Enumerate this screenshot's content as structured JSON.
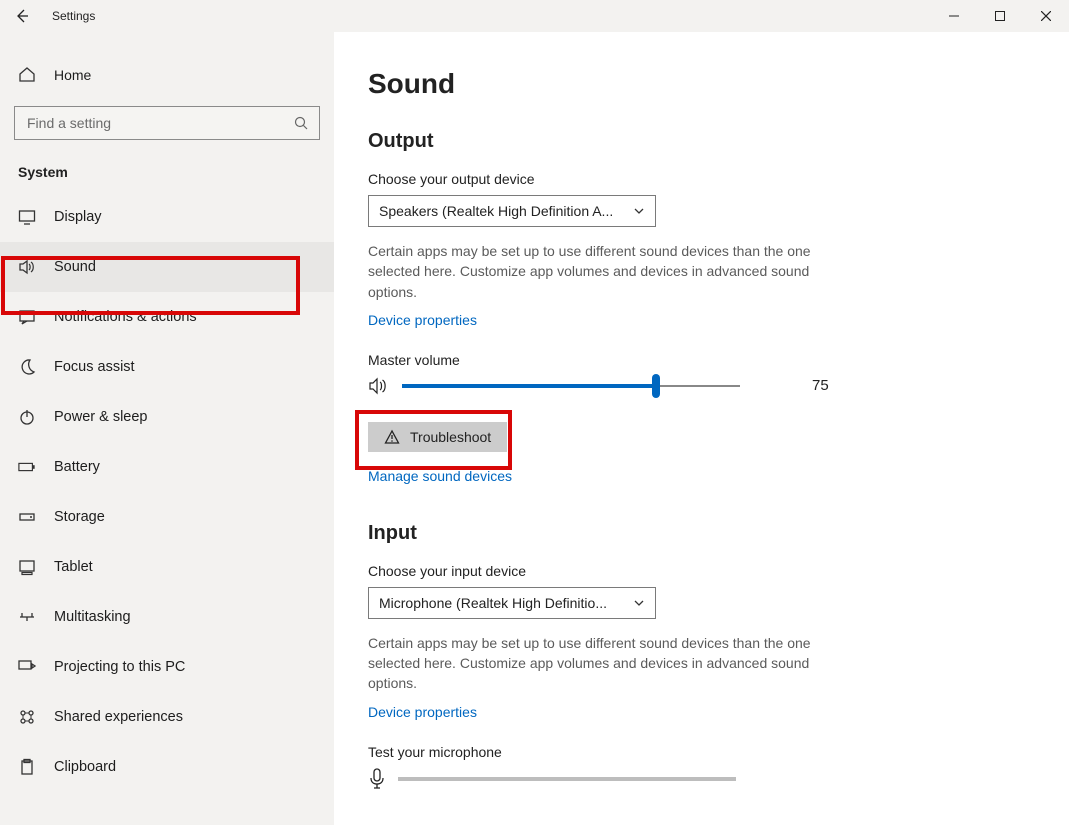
{
  "titlebar": {
    "title": "Settings"
  },
  "sidebar": {
    "home_label": "Home",
    "search_placeholder": "Find a setting",
    "section_title": "System",
    "items": [
      {
        "label": "Display",
        "icon": "display"
      },
      {
        "label": "Sound",
        "icon": "sound",
        "selected": true
      },
      {
        "label": "Notifications & actions",
        "icon": "notif"
      },
      {
        "label": "Focus assist",
        "icon": "moon"
      },
      {
        "label": "Power & sleep",
        "icon": "power"
      },
      {
        "label": "Battery",
        "icon": "battery"
      },
      {
        "label": "Storage",
        "icon": "storage"
      },
      {
        "label": "Tablet",
        "icon": "tablet"
      },
      {
        "label": "Multitasking",
        "icon": "multi"
      },
      {
        "label": "Projecting to this PC",
        "icon": "project"
      },
      {
        "label": "Shared experiences",
        "icon": "shared"
      },
      {
        "label": "Clipboard",
        "icon": "clip"
      }
    ]
  },
  "main": {
    "page_title": "Sound",
    "output": {
      "heading": "Output",
      "choose_label": "Choose your output device",
      "selected_device": "Speakers (Realtek High Definition A...",
      "help": "Certain apps may be set up to use different sound devices than the one selected here. Customize app volumes and devices in advanced sound options.",
      "device_properties": "Device properties",
      "master_volume_label": "Master volume",
      "volume_value": 75,
      "troubleshoot_label": "Troubleshoot",
      "manage_link": "Manage sound devices"
    },
    "input": {
      "heading": "Input",
      "choose_label": "Choose your input device",
      "selected_device": "Microphone (Realtek High Definitio...",
      "help": "Certain apps may be set up to use different sound devices than the one selected here. Customize app volumes and devices in advanced sound options.",
      "device_properties": "Device properties",
      "test_label": "Test your microphone"
    }
  }
}
